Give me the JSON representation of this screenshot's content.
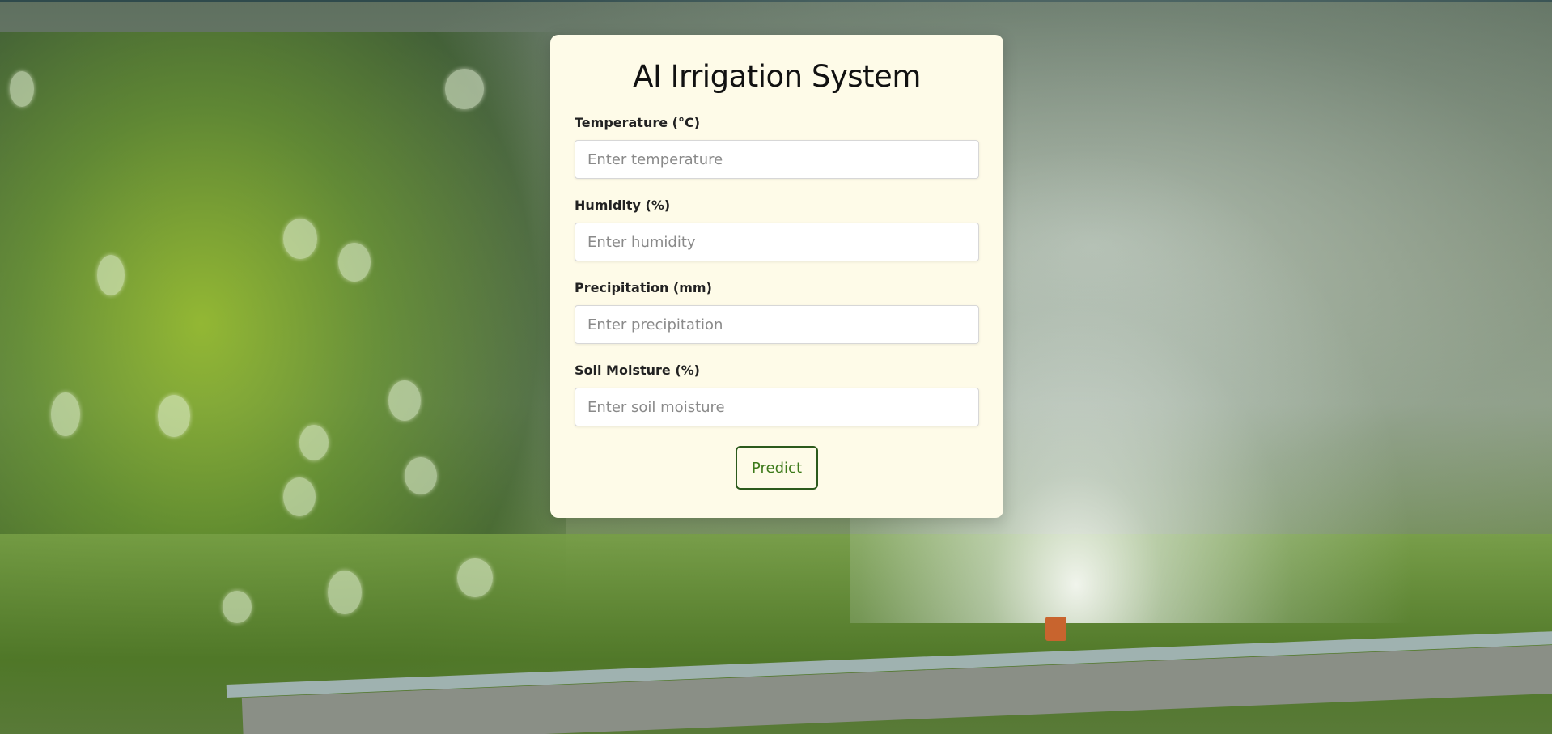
{
  "app": {
    "title": "AI Irrigation System"
  },
  "form": {
    "fields": [
      {
        "label": "Temperature (°C)",
        "placeholder": "Enter temperature",
        "value": ""
      },
      {
        "label": "Humidity (%)",
        "placeholder": "Enter humidity",
        "value": ""
      },
      {
        "label": "Precipitation (mm)",
        "placeholder": "Enter precipitation",
        "value": ""
      },
      {
        "label": "Soil Moisture (%)",
        "placeholder": "Enter soil moisture",
        "value": ""
      }
    ],
    "submit_label": "Predict"
  },
  "colors": {
    "card_background": "#fefbe8",
    "button_border": "#2c5a1c",
    "button_text": "#3d7a1a"
  }
}
